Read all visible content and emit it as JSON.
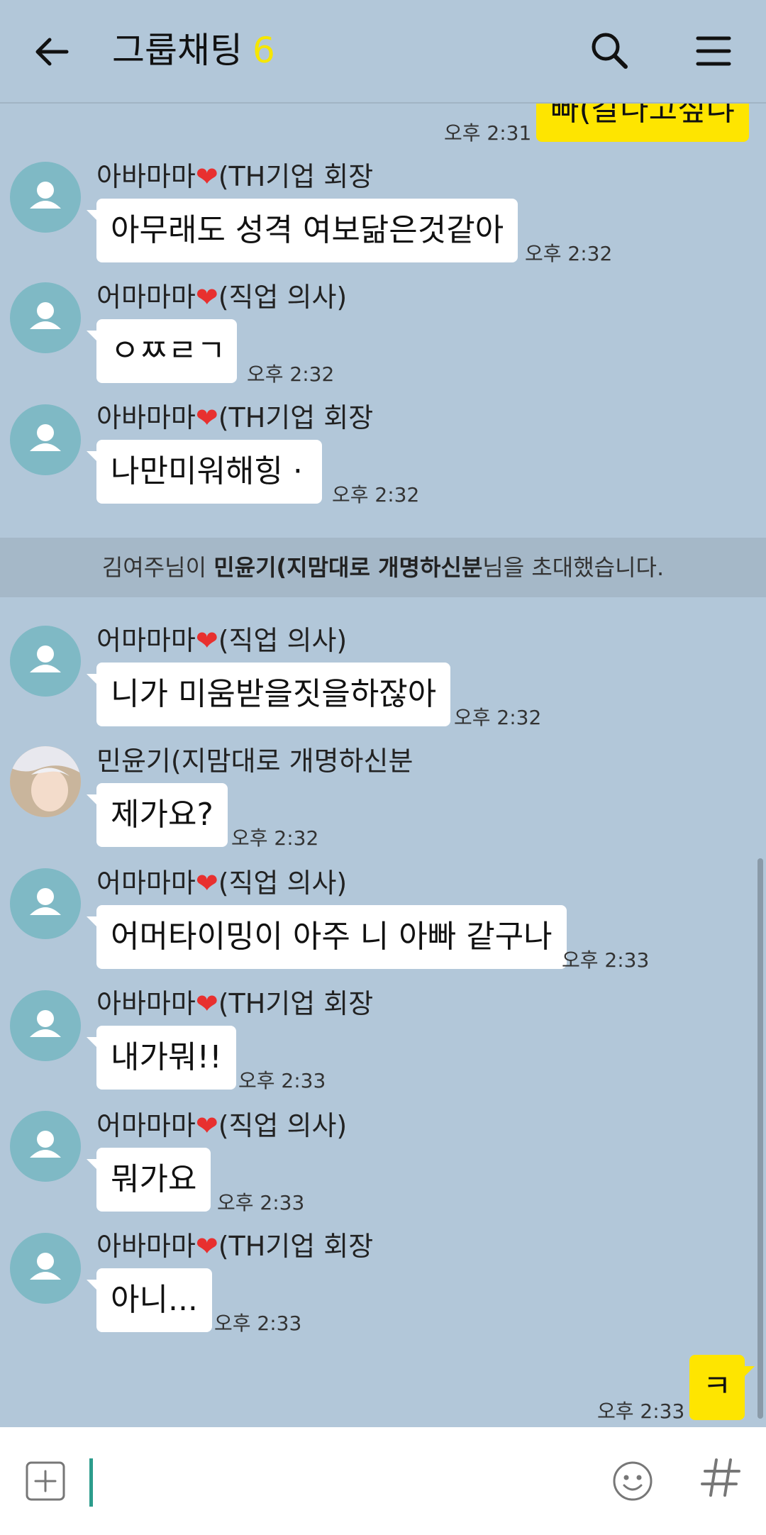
{
  "header": {
    "title": "그룹채팅",
    "member_count": "6"
  },
  "messages": [
    {
      "type": "out",
      "text": "빠(갈나고싶냐",
      "time": "오후 2:31"
    },
    {
      "type": "in",
      "sender": "아바마마",
      "sender_suffix": "(TH기업 회장",
      "text": "아무래도 성격  여보닮은것같아",
      "time": "오후 2:32"
    },
    {
      "type": "in",
      "sender": "어마마마",
      "sender_suffix": "(직업 의사)",
      "text": "ㅇㅉㄹㄱ",
      "time": "오후 2:32"
    },
    {
      "type": "in",
      "sender": "아바마마",
      "sender_suffix": "(TH기업 회장",
      "text": "나만미워해힝 ·",
      "time": "오후 2:32"
    },
    {
      "type": "in",
      "sender": "어마마마",
      "sender_suffix": "(직업 의사)",
      "text": "니가 미움받을짓을하잖아",
      "time": "오후 2:32"
    },
    {
      "type": "in",
      "sender": "민윤기(지맘대로 개명하신분",
      "sender_suffix": "",
      "text": "제가요?",
      "time": "오후 2:32"
    },
    {
      "type": "in",
      "sender": "어마마마",
      "sender_suffix": "(직업 의사)",
      "text": "어머타이밍이 아주 니 아빠 같구나",
      "time": "오후 2:33"
    },
    {
      "type": "in",
      "sender": "아바마마",
      "sender_suffix": "(TH기업 회장",
      "text": "내가뭐!!",
      "time": "오후 2:33"
    },
    {
      "type": "in",
      "sender": "어마마마",
      "sender_suffix": "(직업 의사)",
      "text": "뭐가요",
      "time": "오후 2:33"
    },
    {
      "type": "in",
      "sender": "아바마마",
      "sender_suffix": "(TH기업 회장",
      "text": "아니...",
      "time": "오후 2:33"
    },
    {
      "type": "out",
      "text": "ㅋ",
      "time": "오후 2:33"
    }
  ],
  "notice": {
    "prefix": "김여주님이 ",
    "invitee": "민윤기(지맘대로 개명하신분",
    "suffix": "님을 초대했습니다."
  },
  "heart_glyph": "❤",
  "colors": {
    "background": "#b2c7d9",
    "my_bubble": "#fee500",
    "member_count": "#f6e600",
    "avatar": "#7fb9c5"
  }
}
